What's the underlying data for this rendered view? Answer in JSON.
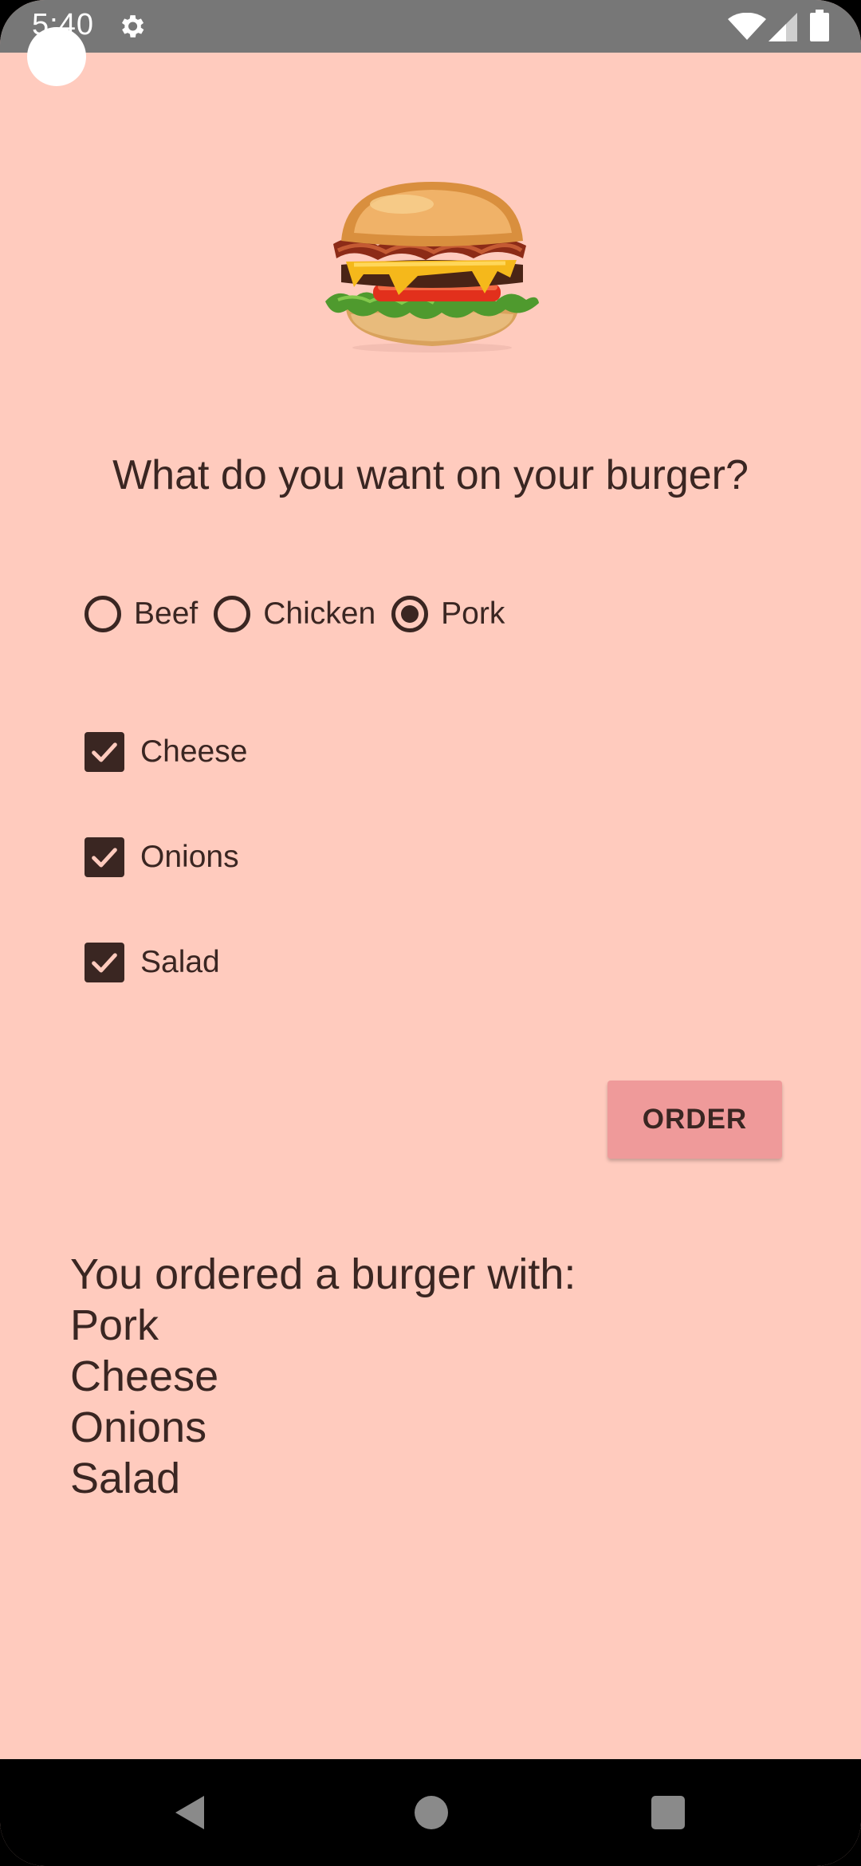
{
  "status_bar": {
    "time": "5:40",
    "icons": [
      "gear-icon",
      "wifi-icon",
      "signal-icon",
      "battery-icon"
    ]
  },
  "main": {
    "question": "What do you want on your burger?",
    "meat_options": [
      {
        "label": "Beef",
        "selected": false
      },
      {
        "label": "Chicken",
        "selected": false
      },
      {
        "label": "Pork",
        "selected": true
      }
    ],
    "toppings": [
      {
        "label": "Cheese",
        "checked": true
      },
      {
        "label": "Onions",
        "checked": true
      },
      {
        "label": "Salad",
        "checked": true
      }
    ],
    "order_label": "ORDER",
    "summary": {
      "intro": "You ordered a burger with:",
      "items": [
        "Pork",
        "Cheese",
        "Onions",
        "Salad"
      ]
    }
  },
  "colors": {
    "background": "#FFCBBE",
    "text": "#3A2622",
    "button": "#EF9A9A",
    "status_bar": "#777777"
  }
}
